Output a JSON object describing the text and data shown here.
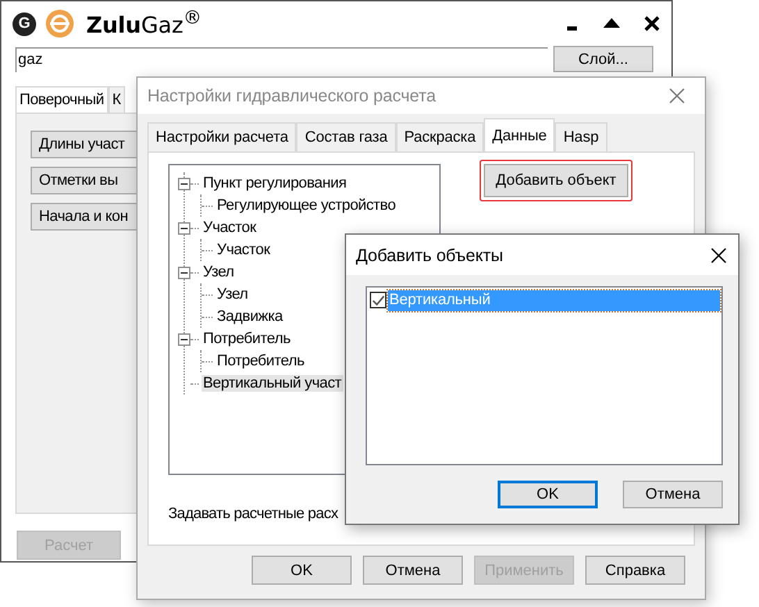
{
  "main_window": {
    "logo_letter": "G",
    "app_name": "**Zulu**Gaz$^{®}$",
    "layer_field": {
      "value": "gaz"
    },
    "layer_button": "Слой...",
    "tabs": [
      {
        "label": "Поверочный",
        "selected": true
      },
      {
        "label": "К",
        "selected": false
      }
    ],
    "buttons": [
      "Длины участ",
      "Отметки вы",
      "Начала и кон"
    ],
    "run_button": {
      "label": "Расчет",
      "disabled": true
    }
  },
  "settings_dialog": {
    "title": "Настройки гидравлического расчета",
    "active": false,
    "tabs": [
      {
        "label": "Настройки расчета",
        "selected": false
      },
      {
        "label": "Состав газа",
        "selected": false
      },
      {
        "label": "Раскраска",
        "selected": false
      },
      {
        "label": "Данные",
        "selected": true
      },
      {
        "label": "Hasp",
        "selected": false
      }
    ],
    "tree": [
      {
        "label": "Пункт регулирования",
        "expanded": true,
        "selected": false,
        "children": [
          {
            "label": "Регулирующее устройство",
            "selected": false
          }
        ]
      },
      {
        "label": "Участок",
        "expanded": true,
        "selected": false,
        "children": [
          {
            "label": "Участок",
            "selected": false
          }
        ]
      },
      {
        "label": "Узел",
        "expanded": true,
        "selected": false,
        "children": [
          {
            "label": "Узел",
            "selected": false
          },
          {
            "label": "Задвижка",
            "selected": false
          }
        ]
      },
      {
        "label": "Потребитель",
        "expanded": true,
        "selected": false,
        "children": [
          {
            "label": "Потребитель",
            "selected": false
          }
        ]
      },
      {
        "label": "Вертикальный участ",
        "expanded": false,
        "selected": true
      }
    ],
    "add_button": {
      "label": "Добавить объект",
      "highlighted": true
    },
    "note": "Задавать расчетные расх",
    "buttons": [
      {
        "label": "OK",
        "disabled": false
      },
      {
        "label": "Отмена",
        "disabled": false
      },
      {
        "label": "Применить",
        "disabled": true
      },
      {
        "label": "Справка",
        "disabled": false
      }
    ]
  },
  "add_dialog": {
    "title": "Добавить объекты",
    "items": [
      {
        "label": "Вертикальный",
        "checked": true,
        "selected": true
      }
    ],
    "buttons": [
      {
        "label": "OK",
        "default": true
      },
      {
        "label": "Отмена",
        "default": false
      }
    ]
  }
}
